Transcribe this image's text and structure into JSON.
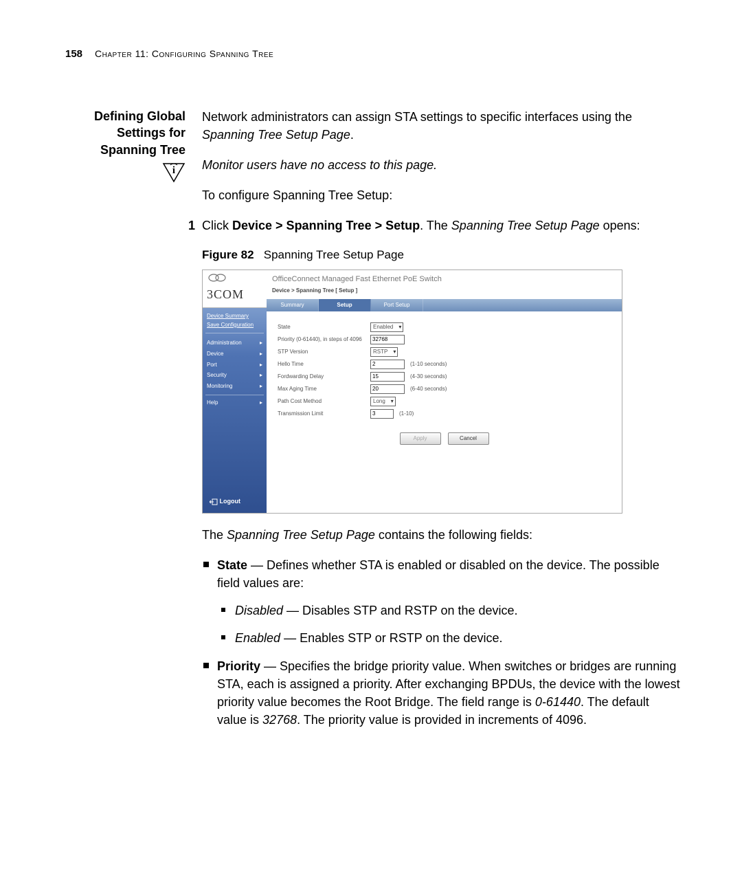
{
  "page": {
    "number": "158",
    "chapter": "Chapter 11: Configuring Spanning Tree"
  },
  "section_heading": "Defining Global Settings for Spanning Tree",
  "intro": {
    "line1_pre": "Network administrators can assign STA settings to specific interfaces using the ",
    "line1_em": "Spanning Tree Setup Page",
    "line1_post": ".",
    "note": "Monitor users have no access to this page.",
    "lead": "To configure Spanning Tree Setup:"
  },
  "step1": {
    "num": "1",
    "pre": "Click ",
    "bold": "Device > Spanning Tree > Setup",
    "mid": ". The ",
    "em": "Spanning Tree Setup Page",
    "post": " opens:"
  },
  "figure": {
    "label": "Figure 82",
    "caption": "Spanning Tree Setup Page"
  },
  "screenshot": {
    "product_title": "OfficeConnect Managed Fast Ethernet PoE Switch",
    "breadcrumb": "Device > Spanning Tree [ Setup ]",
    "logo": "3COM",
    "sidebar_links": {
      "summary": "Device Summary",
      "save": "Save Configuration"
    },
    "menu": [
      "Administration",
      "Device",
      "Port",
      "Security",
      "Monitoring"
    ],
    "help_label": "Help",
    "logout": "Logout",
    "tabs": [
      "Summary",
      "Setup",
      "Port Setup"
    ],
    "active_tab_index": 1,
    "form": {
      "state": {
        "label": "State",
        "value": "Enabled"
      },
      "priority": {
        "label": "Priority (0-61440), in steps of 4096",
        "value": "32768"
      },
      "stp_version": {
        "label": "STP Version",
        "value": "RSTP"
      },
      "hello": {
        "label": "Hello Time",
        "value": "2",
        "hint": "(1-10 seconds)"
      },
      "forward": {
        "label": "Fordwarding Delay",
        "value": "15",
        "hint": "(4-30 seconds)"
      },
      "max_age": {
        "label": "Max Aging Time",
        "value": "20",
        "hint": "(6-40 seconds)"
      },
      "path_cost": {
        "label": "Path Cost Method",
        "value": "Long"
      },
      "tx_limit": {
        "label": "Transmission Limit",
        "value": "3",
        "hint": "(1-10)"
      }
    },
    "buttons": {
      "apply": "Apply",
      "cancel": "Cancel"
    }
  },
  "after_figure": {
    "lead_pre": "The ",
    "lead_em": "Spanning Tree Setup Page",
    "lead_post": " contains the following fields:",
    "state": {
      "name": "State",
      "desc": " — Defines whether STA is enabled or disabled on the device. The possible field values are:",
      "disabled_name": "Disabled",
      "disabled_desc": " — Disables STP and RSTP on the device.",
      "enabled_name": "Enabled",
      "enabled_desc": " — Enables STP or RSTP on the device."
    },
    "priority": {
      "name": "Priority",
      "desc_pre": " — Specifies the bridge priority value. When switches or bridges are running STA, each is assigned a priority. After exchanging BPDUs, the device with the lowest priority value becomes the Root Bridge. The field range is ",
      "range": "0-61440",
      "desc_mid": ". The default value is ",
      "default": "32768",
      "desc_post": ". The priority value is provided in increments of 4096."
    }
  }
}
